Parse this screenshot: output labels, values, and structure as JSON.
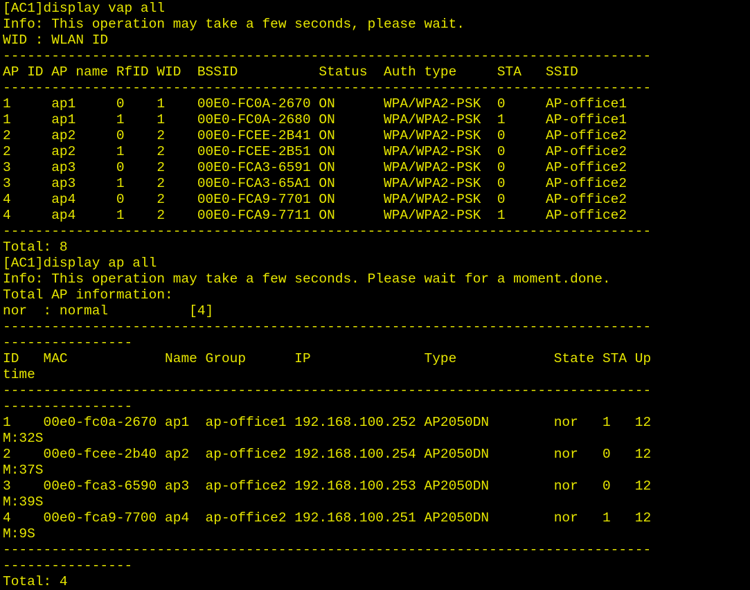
{
  "terminal": {
    "text_color": "#e6e600",
    "background_color": "#000000",
    "lines": [
      "[AC1]display vap all",
      "Info: This operation may take a few seconds, please wait.",
      "WID : WLAN ID",
      "--------------------------------------------------------------------------------",
      "AP ID AP name RfID WID  BSSID          Status  Auth type     STA   SSID",
      "--------------------------------------------------------------------------------",
      "1     ap1     0    1    00E0-FC0A-2670 ON      WPA/WPA2-PSK  0     AP-office1",
      "1     ap1     1    1    00E0-FC0A-2680 ON      WPA/WPA2-PSK  1     AP-office1",
      "2     ap2     0    2    00E0-FCEE-2B41 ON      WPA/WPA2-PSK  0     AP-office2",
      "2     ap2     1    2    00E0-FCEE-2B51 ON      WPA/WPA2-PSK  0     AP-office2",
      "3     ap3     0    2    00E0-FCA3-6591 ON      WPA/WPA2-PSK  0     AP-office2",
      "3     ap3     1    2    00E0-FCA3-65A1 ON      WPA/WPA2-PSK  0     AP-office2",
      "4     ap4     0    2    00E0-FCA9-7701 ON      WPA/WPA2-PSK  0     AP-office2",
      "4     ap4     1    2    00E0-FCA9-7711 ON      WPA/WPA2-PSK  1     AP-office2",
      "--------------------------------------------------------------------------------",
      "Total: 8",
      "[AC1]display ap all",
      "Info: This operation may take a few seconds. Please wait for a moment.done.",
      "Total AP information:",
      "nor  : normal          [4]",
      "--------------------------------------------------------------------------------",
      "----------------",
      "ID   MAC            Name Group      IP              Type            State STA Up",
      "time",
      "--------------------------------------------------------------------------------",
      "----------------",
      "1    00e0-fc0a-2670 ap1  ap-office1 192.168.100.252 AP2050DN        nor   1   12",
      "M:32S",
      "2    00e0-fcee-2b40 ap2  ap-office2 192.168.100.254 AP2050DN        nor   0   12",
      "M:37S",
      "3    00e0-fca3-6590 ap3  ap-office2 192.168.100.253 AP2050DN        nor   0   12",
      "M:39S",
      "4    00e0-fca9-7700 ap4  ap-office2 192.168.100.251 AP2050DN        nor   1   12",
      "M:9S",
      "--------------------------------------------------------------------------------",
      "----------------",
      "Total: 4"
    ]
  }
}
